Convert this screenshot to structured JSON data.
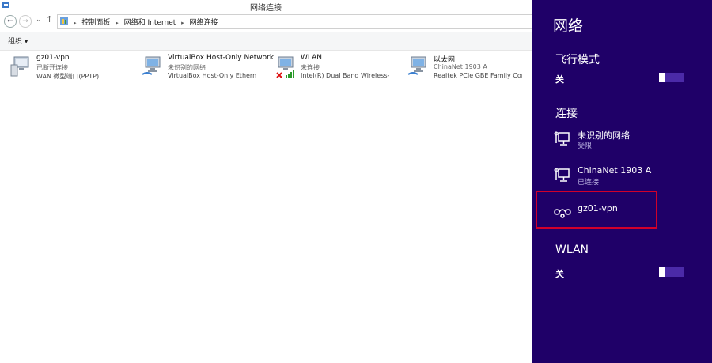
{
  "window": {
    "title": "网络连接"
  },
  "nav": {
    "back": "←",
    "forward": "→",
    "dropdown": "⌄",
    "up": "↑"
  },
  "breadcrumbs": [
    "控制面板",
    "网络和 Internet",
    "网络连接"
  ],
  "toolbar": {
    "organize": "组织 ▾"
  },
  "connections": [
    {
      "name": "gz01-vpn",
      "status": "已断开连接",
      "device": "WAN 微型端口(PPTP)",
      "icon": "vpn-connection-icon"
    },
    {
      "name": "VirtualBox Host-Only Network",
      "status": "未识别的网络",
      "device": "VirtualBox Host-Only Ethernet ...",
      "icon": "ethernet-connection-icon"
    },
    {
      "name": "WLAN",
      "status": "未连接",
      "device": "Intel(R) Dual Band Wireless-N ...",
      "icon": "wlan-connection-icon"
    },
    {
      "name": "以太网",
      "status": "ChinaNet 1903 A",
      "device": "Realtek PCIe GBE Family Contr...",
      "icon": "ethernet-connection-icon"
    }
  ],
  "charm": {
    "title": "网络",
    "airplane": {
      "label": "飞行模式",
      "state": "关"
    },
    "connections_label": "连接",
    "networks": [
      {
        "name": "未识别的网络",
        "status": "受限",
        "icon": "wired-network-icon"
      },
      {
        "name": "ChinaNet 1903 A",
        "status": "已连接",
        "icon": "wired-network-icon"
      },
      {
        "name": "gz01-vpn",
        "status": "",
        "icon": "vpn-icon"
      }
    ],
    "wlan": {
      "label": "WLAN",
      "state": "关"
    }
  },
  "colors": {
    "charm_bg": "#1f0068",
    "toggle_track": "#4b2aa8",
    "highlight": "#d1002a"
  }
}
